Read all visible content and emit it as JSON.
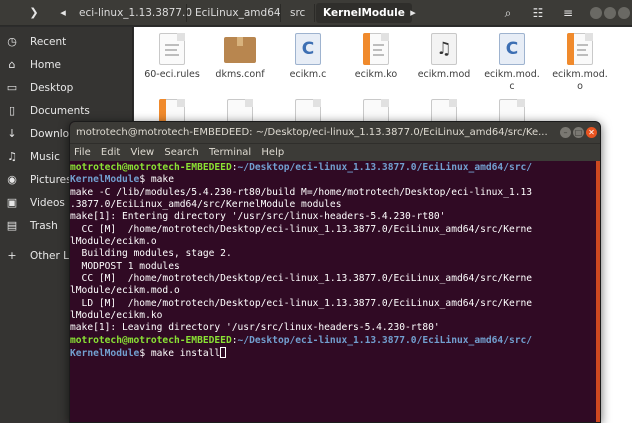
{
  "header": {
    "breadcrumbs": [
      "eci-linux_1.13.3877.0",
      "EciLinux_amd64",
      "src",
      "KernelModule"
    ],
    "icons": [
      "chevron-right-icon",
      "chevron-left-icon",
      "search-icon",
      "view-list-icon",
      "menu-icon"
    ]
  },
  "sidebar": {
    "items": [
      {
        "label": "Recent",
        "icon": "clock-icon"
      },
      {
        "label": "Home",
        "icon": "home-icon"
      },
      {
        "label": "Desktop",
        "icon": "desktop-icon"
      },
      {
        "label": "Documents",
        "icon": "document-icon"
      },
      {
        "label": "Downlo",
        "icon": "download-icon"
      },
      {
        "label": "Music",
        "icon": "music-icon"
      },
      {
        "label": "Pictures",
        "icon": "camera-icon"
      },
      {
        "label": "Videos",
        "icon": "video-icon"
      },
      {
        "label": "Trash",
        "icon": "trash-icon"
      },
      {
        "label": "Other Lo",
        "icon": "plus-icon"
      }
    ]
  },
  "files": [
    {
      "name": "60-eci.rules",
      "kind": "text"
    },
    {
      "name": "dkms.conf",
      "kind": "package"
    },
    {
      "name": "ecikm.c",
      "kind": "c-source"
    },
    {
      "name": "ecikm.ko",
      "kind": "orange-doc"
    },
    {
      "name": "ecikm.mod",
      "kind": "music"
    },
    {
      "name": "ecikm.mod.\nc",
      "kind": "c-source"
    },
    {
      "name": "ecikm.mod.\no",
      "kind": "orange-doc"
    }
  ],
  "terminal": {
    "title": "motrotech@motrotech-EMBEDEED: ~/Desktop/eci-linux_1.13.3877.0/EciLinux_amd64/src/Ke...",
    "menu": [
      "File",
      "Edit",
      "View",
      "Search",
      "Terminal",
      "Help"
    ],
    "prompt_user": "motrotech@motrotech-EMBEDEED",
    "lines": [
      {
        "type": "prompt",
        "path": "~/Desktop/eci-linux_1.13.3877.0/EciLinux_amd64/src/",
        "cmd": ""
      },
      {
        "type": "prompt-cont",
        "path": "KernelModule",
        "cmd": "$ make"
      },
      {
        "type": "out",
        "text": "make -C /lib/modules/5.4.230-rt80/build M=/home/motrotech/Desktop/eci-linux_1.13"
      },
      {
        "type": "out",
        "text": ".3877.0/EciLinux_amd64/src/KernelModule modules"
      },
      {
        "type": "out",
        "text": "make[1]: Entering directory '/usr/src/linux-headers-5.4.230-rt80'"
      },
      {
        "type": "out",
        "text": "  CC [M]  /home/motrotech/Desktop/eci-linux_1.13.3877.0/EciLinux_amd64/src/Kerne"
      },
      {
        "type": "out",
        "text": "lModule/ecikm.o"
      },
      {
        "type": "out",
        "text": "  Building modules, stage 2."
      },
      {
        "type": "out",
        "text": "  MODPOST 1 modules"
      },
      {
        "type": "out",
        "text": "  CC [M]  /home/motrotech/Desktop/eci-linux_1.13.3877.0/EciLinux_amd64/src/Kerne"
      },
      {
        "type": "out",
        "text": "lModule/ecikm.mod.o"
      },
      {
        "type": "out",
        "text": "  LD [M]  /home/motrotech/Desktop/eci-linux_1.13.3877.0/EciLinux_amd64/src/Kerne"
      },
      {
        "type": "out",
        "text": "lModule/ecikm.ko"
      },
      {
        "type": "out",
        "text": "make[1]: Leaving directory '/usr/src/linux-headers-5.4.230-rt80'"
      },
      {
        "type": "prompt",
        "path": "~/Desktop/eci-linux_1.13.3877.0/EciLinux_amd64/src/",
        "cmd": ""
      },
      {
        "type": "prompt-cont",
        "path": "KernelModule",
        "cmd": "$ make install",
        "cursor": true
      }
    ]
  },
  "colors": {
    "terminal_bg": "#300a24",
    "prompt_user": "#8ae234",
    "prompt_path": "#729fcf",
    "accent": "#e95420"
  }
}
